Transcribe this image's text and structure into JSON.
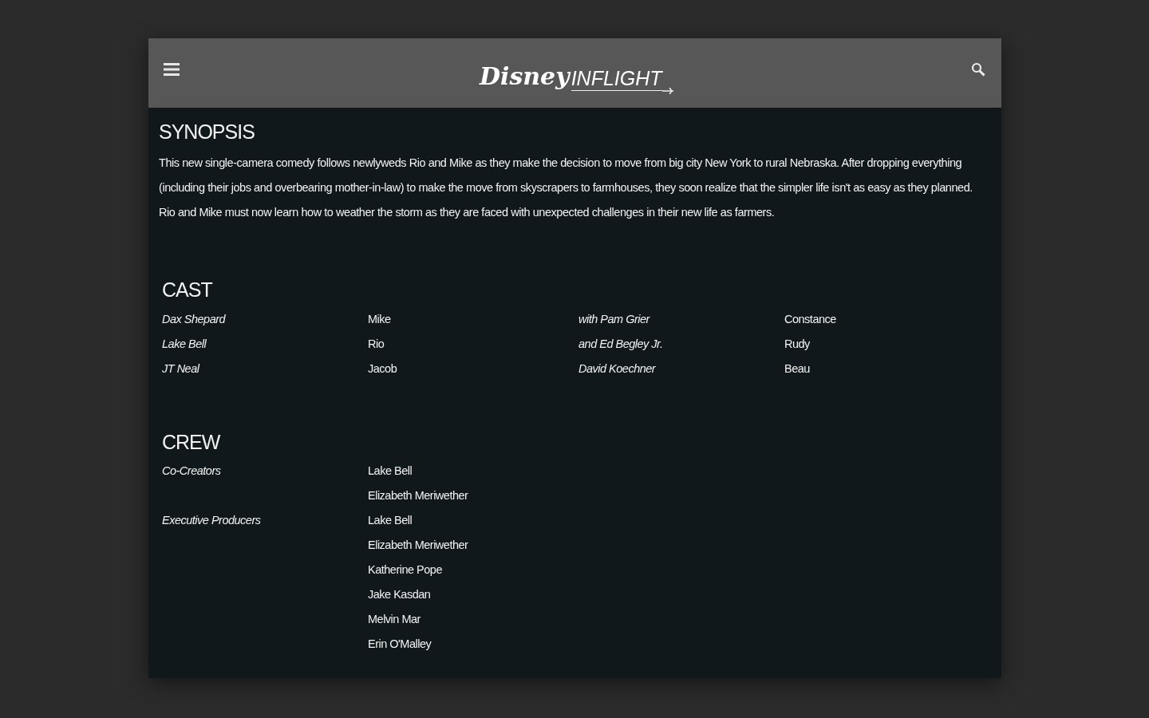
{
  "header": {
    "logo_script": "Disney",
    "logo_text": "INFLIGHT"
  },
  "synopsis": {
    "heading": "SYNOPSIS",
    "text": "This new single-camera comedy follows newlyweds Rio and Mike as they make the decision to move from big city New York to rural Nebraska. After dropping everything (including their jobs and overbearing mother-in-law) to make the move from skyscrapers to farmhouses, they soon realize that the simpler life isn't as easy as they planned. Rio and Mike must now learn how to weather the storm as they are faced with unexpected challenges in their new life as farmers."
  },
  "cast": {
    "heading": "CAST",
    "groups": [
      [
        {
          "actor": "Dax Shepard",
          "role": "Mike"
        },
        {
          "actor": "Lake Bell",
          "role": "Rio"
        },
        {
          "actor": "JT Neal",
          "role": "Jacob"
        }
      ],
      [
        {
          "actor": "with Pam Grier",
          "role": "Constance"
        },
        {
          "actor": "and Ed Begley Jr.",
          "role": "Rudy"
        },
        {
          "actor": "David Koechner",
          "role": "Beau"
        }
      ]
    ]
  },
  "crew": {
    "heading": "CREW",
    "roles": [
      {
        "role": "Co-Creators",
        "names": [
          "Lake Bell",
          "Elizabeth Meriwether"
        ]
      },
      {
        "role": "Executive Producers",
        "names": [
          "Lake Bell",
          "Elizabeth Meriwether",
          "Katherine Pope",
          "Jake Kasdan",
          "Melvin Mar",
          "Erin O'Malley"
        ]
      }
    ]
  }
}
